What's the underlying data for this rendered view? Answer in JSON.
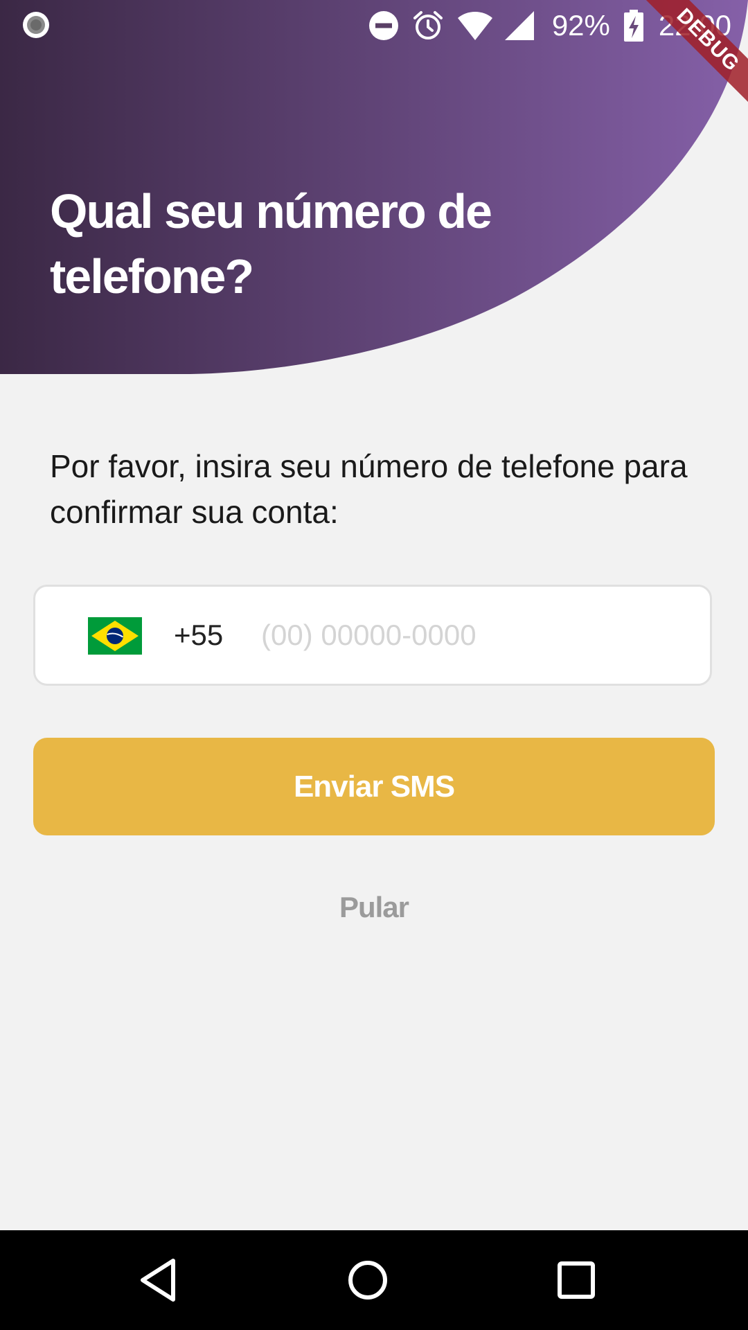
{
  "colors": {
    "header_gradient_start": "#3b2845",
    "header_gradient_end": "#8560a8",
    "background": "#f2f2f2",
    "primary_button": "#e8b745",
    "skip_text": "#9b9b9b",
    "debug_banner": "#a01e28"
  },
  "status_bar": {
    "icons": [
      "screen-record-icon",
      "do-not-disturb-icon",
      "alarm-icon",
      "wifi-icon",
      "signal-icon",
      "battery-charging-icon"
    ],
    "battery": "92%",
    "time": "22:00"
  },
  "debug_banner": {
    "label": "DEBUG"
  },
  "header": {
    "title": "Qual seu número de telefone?"
  },
  "main": {
    "description": "Por favor, insira seu número de telefone para confirmar sua conta:",
    "phone": {
      "country_flag": "brazil-flag-icon",
      "dial_code": "+55",
      "value": "",
      "placeholder": "(00) 00000-0000"
    },
    "send_button_label": "Enviar SMS",
    "skip_label": "Pular"
  },
  "nav_bar": {
    "buttons": [
      "back-icon",
      "home-icon",
      "recents-icon"
    ]
  }
}
